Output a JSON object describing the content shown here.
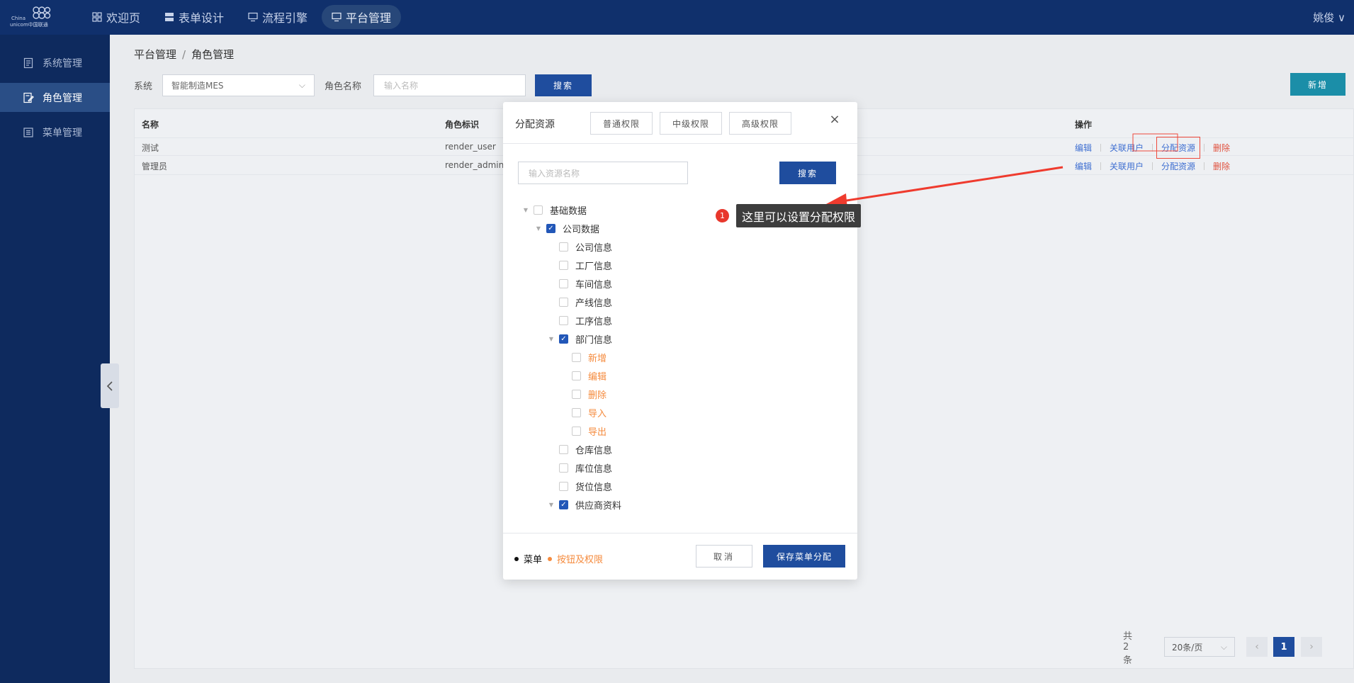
{
  "header": {
    "logo_text_1": "China",
    "logo_text_2": "unicom中国联通",
    "nav": [
      {
        "label": "欢迎页"
      },
      {
        "label": "表单设计"
      },
      {
        "label": "流程引擎"
      },
      {
        "label": "平台管理"
      }
    ],
    "active_nav": "平台管理",
    "user": "姚俊 ∨"
  },
  "sidebar": {
    "items": [
      {
        "label": "系统管理"
      },
      {
        "label": "角色管理"
      },
      {
        "label": "菜单管理"
      }
    ],
    "active": "角色管理"
  },
  "breadcrumb": {
    "parent": "平台管理",
    "separator": "/",
    "current": "角色管理"
  },
  "filters": {
    "system_label": "系统",
    "system_value": "智能制造MES",
    "role_label": "角色名称",
    "role_placeholder": "输入名称",
    "search_button": "搜索",
    "new_button": "新增"
  },
  "table": {
    "columns": [
      "名称",
      "角色标识",
      "操作"
    ],
    "rows": [
      {
        "name": "测试",
        "key": "render_user"
      },
      {
        "name": "管理员",
        "key": "render_admin"
      }
    ],
    "ops": [
      "编辑",
      "关联用户",
      "分配资源",
      "删除"
    ]
  },
  "pagination": {
    "total": "共 2 条",
    "page_size": "20条/页",
    "prev": "‹",
    "current": "1",
    "next": "›"
  },
  "modal": {
    "title": "分配资源",
    "tabs": [
      "普通权限",
      "中级权限",
      "高级权限"
    ],
    "close": "×",
    "search_placeholder": "输入资源名称",
    "search_button": "搜索",
    "tree": [
      {
        "label": "基础数据",
        "level": 0,
        "checked": false,
        "caret": true,
        "type": "menu"
      },
      {
        "label": "公司数据",
        "level": 1,
        "checked": true,
        "caret": true,
        "type": "menu"
      },
      {
        "label": "公司信息",
        "level": 2,
        "checked": false,
        "caret": false,
        "type": "menu"
      },
      {
        "label": "工厂信息",
        "level": 2,
        "checked": false,
        "caret": false,
        "type": "menu"
      },
      {
        "label": "车间信息",
        "level": 2,
        "checked": false,
        "caret": false,
        "type": "menu"
      },
      {
        "label": "产线信息",
        "level": 2,
        "checked": false,
        "caret": false,
        "type": "menu"
      },
      {
        "label": "工序信息",
        "level": 2,
        "checked": false,
        "caret": false,
        "type": "menu"
      },
      {
        "label": "部门信息",
        "level": 2,
        "checked": true,
        "caret": true,
        "type": "menu"
      },
      {
        "label": "新增",
        "level": 3,
        "checked": false,
        "caret": false,
        "type": "button"
      },
      {
        "label": "编辑",
        "level": 3,
        "checked": false,
        "caret": false,
        "type": "button"
      },
      {
        "label": "删除",
        "level": 3,
        "checked": false,
        "caret": false,
        "type": "button"
      },
      {
        "label": "导入",
        "level": 3,
        "checked": false,
        "caret": false,
        "type": "button"
      },
      {
        "label": "导出",
        "level": 3,
        "checked": false,
        "caret": false,
        "type": "button"
      },
      {
        "label": "仓库信息",
        "level": 2,
        "checked": false,
        "caret": false,
        "type": "menu"
      },
      {
        "label": "库位信息",
        "level": 2,
        "checked": false,
        "caret": false,
        "type": "menu"
      },
      {
        "label": "货位信息",
        "level": 2,
        "checked": false,
        "caret": false,
        "type": "menu"
      },
      {
        "label": "供应商资料",
        "level": 2,
        "checked": true,
        "caret": true,
        "type": "menu"
      }
    ],
    "legend_menu": "菜单",
    "legend_button": "按钮及权限",
    "cancel": "取消",
    "save": "保存菜单分配"
  },
  "annotation": {
    "badge": "1",
    "text": "这里可以设置分配权限"
  },
  "colors": {
    "topbar": "#10306c",
    "sidebar": "#0e2a5e",
    "primary": "#1f4d9e",
    "teal": "#1b8ea8",
    "link": "#3f6fd1",
    "danger": "#e0513e",
    "orange": "#f58b3e",
    "annotation_red": "#e8372c"
  }
}
